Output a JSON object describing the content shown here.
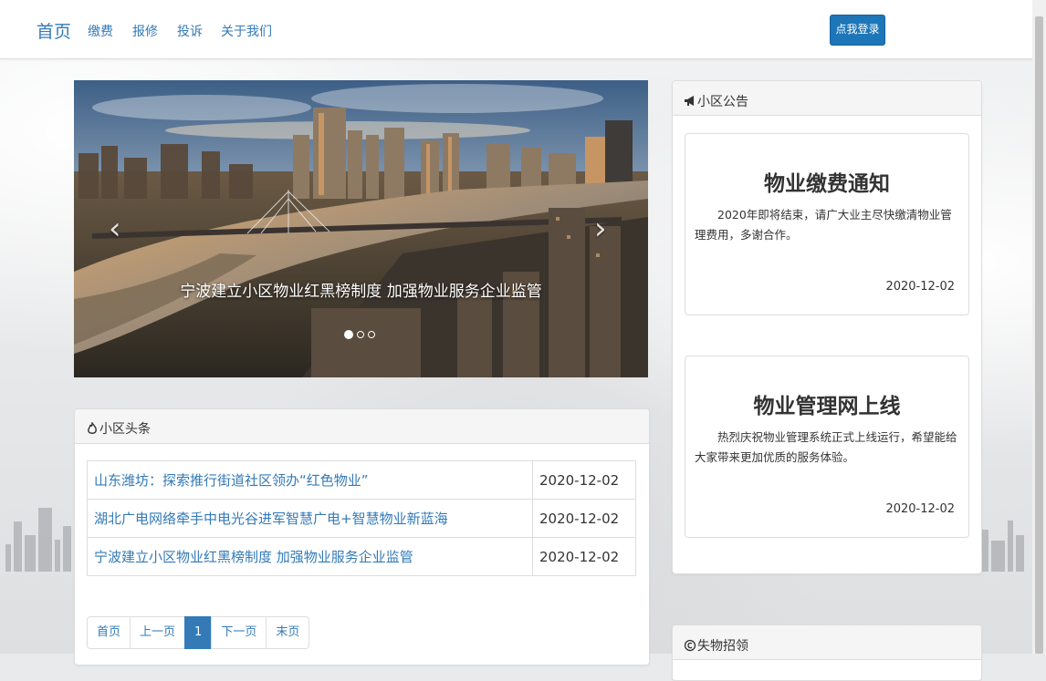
{
  "nav": {
    "brand": "首页",
    "links": [
      "缴费",
      "报修",
      "投诉",
      "关于我们"
    ],
    "login_label": "点我登录"
  },
  "carousel": {
    "caption": "宁波建立小区物业红黑榜制度 加强物业服务企业监管",
    "prev_glyph": "‹",
    "next_glyph": "›",
    "slide_count": 3,
    "active_slide": 1
  },
  "news": {
    "heading": "小区头条",
    "rows": [
      {
        "title": "山东潍坊：探索推行街道社区领办“红色物业”",
        "date": "2020-12-02"
      },
      {
        "title": "湖北广电网络牵手中电光谷进军智慧广电+智慧物业新蓝海",
        "date": "2020-12-02"
      },
      {
        "title": "宁波建立小区物业红黑榜制度 加强物业服务企业监管",
        "date": "2020-12-02"
      }
    ],
    "pagination": {
      "first": "首页",
      "prev": "上一页",
      "current": "1",
      "next": "下一页",
      "last": "末页"
    }
  },
  "announcements": {
    "heading": "小区公告",
    "items": [
      {
        "title": "物业缴费通知",
        "body": "2020年即将结束，请广大业主尽快缴清物业管理费用，多谢合作。",
        "date": "2020-12-02"
      },
      {
        "title": "物业管理网上线",
        "body": "热烈庆祝物业管理系统正式上线运行，希望能给大家带来更加优质的服务体验。",
        "date": "2020-12-02"
      }
    ]
  },
  "lost_found": {
    "heading": "失物招领"
  },
  "colors": {
    "link": "#337ab7",
    "button": "#1d76b8"
  }
}
